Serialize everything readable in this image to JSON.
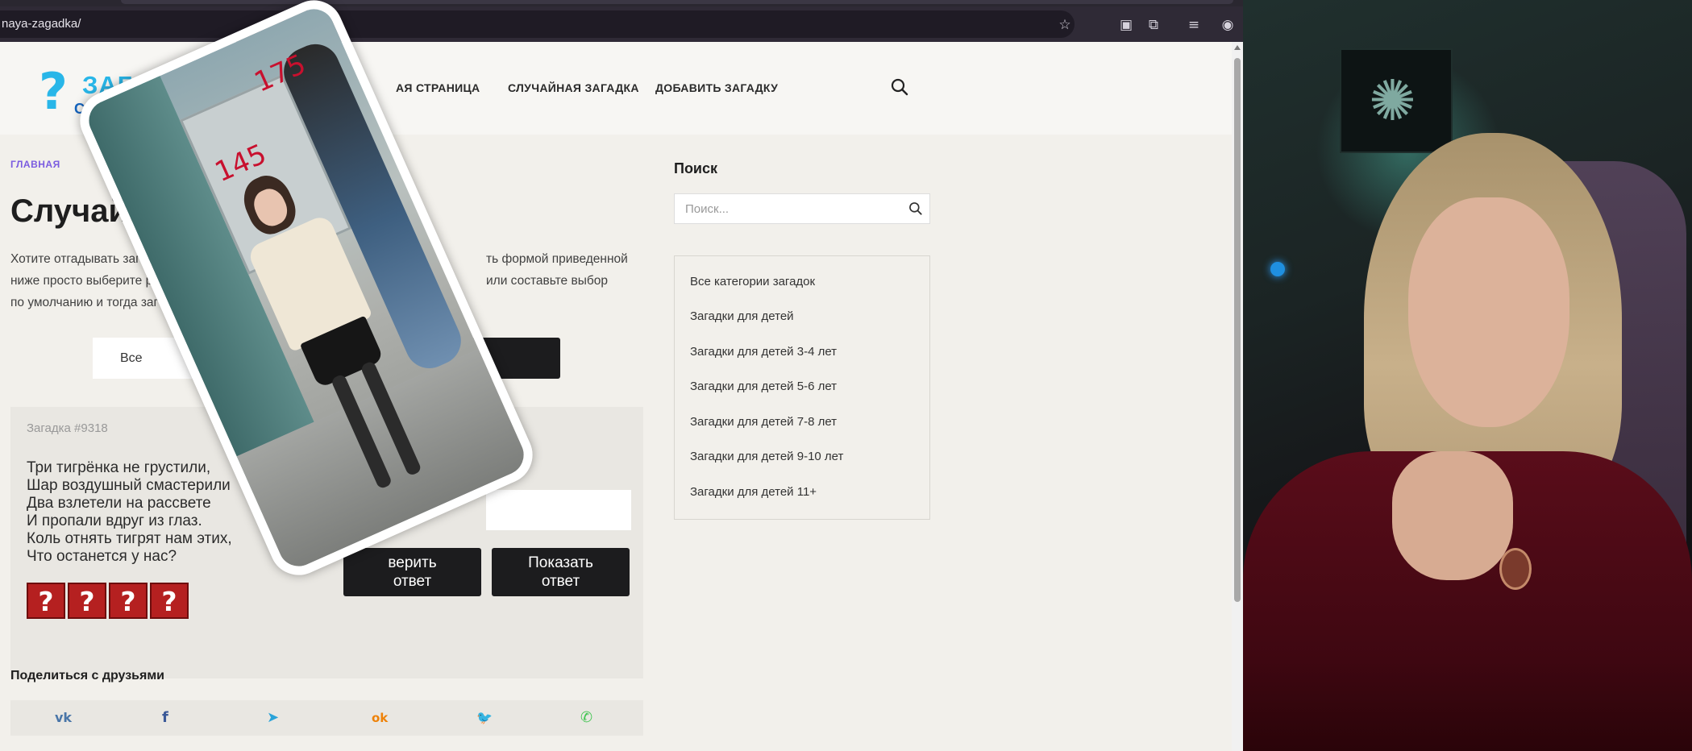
{
  "browser": {
    "url": "naya-zagadka/",
    "toolbar_icons": [
      "star-icon",
      "extension-badge-icon",
      "puzzle-icon",
      "media-icon",
      "profile-avatar-icon",
      "menu-dots-icon"
    ]
  },
  "site": {
    "logo_main": "ЗАГАДК",
    "logo_sub": "С ОТВЕТ",
    "nav": [
      "АЯ СТРАНИЦА",
      "СЛУЧАЙНАЯ ЗАГАДКА",
      "ДОБАВИТЬ ЗАГАДКУ"
    ]
  },
  "main": {
    "breadcrumb": "ГЛАВНАЯ",
    "title": "Случайн",
    "intro_lines": [
      "Хотите отгадывать загад",
      "ть формой приведенной",
      "ниже просто выберите р",
      "или составьте выбор",
      "по умолчанию и тогда заг"
    ],
    "select_value": "Все"
  },
  "riddle": {
    "number": "Загадка #9318",
    "poem": [
      "Три тигрёнка не грустили,",
      "Шар воздушный смастерили",
      "Два взлетели на рассвете",
      "И пропали вдруг из глаз.",
      "Коль отнять тигрят нам этих,",
      "Что останется у нас?"
    ],
    "check_button": [
      "верить",
      "ответ"
    ],
    "show_button": [
      "Показать",
      "ответ"
    ],
    "hint_tiles": [
      "?",
      "?",
      "?",
      "?"
    ]
  },
  "share": {
    "title": "Поделиться с друзьями",
    "networks": [
      {
        "name": "vk",
        "glyph": "vk",
        "color": "#4a76a8"
      },
      {
        "name": "facebook",
        "glyph": "f",
        "color": "#3b5998"
      },
      {
        "name": "telegram",
        "glyph": "➤",
        "color": "#2aa3d9"
      },
      {
        "name": "odnoklassniki",
        "glyph": "ok",
        "color": "#ee8208"
      },
      {
        "name": "twitter",
        "glyph": "🐦",
        "color": "#1da1f2"
      },
      {
        "name": "whatsapp",
        "glyph": "✆",
        "color": "#43c553"
      }
    ]
  },
  "sidebar": {
    "search_title": "Поиск",
    "search_placeholder": "Поиск...",
    "categories": [
      "Все категории загадок",
      "Загадки для детей",
      "Загадки для детей 3-4 лет",
      "Загадки для детей 5-6 лет",
      "Загадки для детей 7-8 лет",
      "Загадки для детей 9-10 лет",
      "Загадки для детей 11+"
    ]
  },
  "overlay_video": {
    "label_top": "175",
    "label_left": "145"
  },
  "colors": {
    "accent": "#29b6e8",
    "breadcrumb": "#7b5ce0",
    "tile": "#b52020"
  }
}
